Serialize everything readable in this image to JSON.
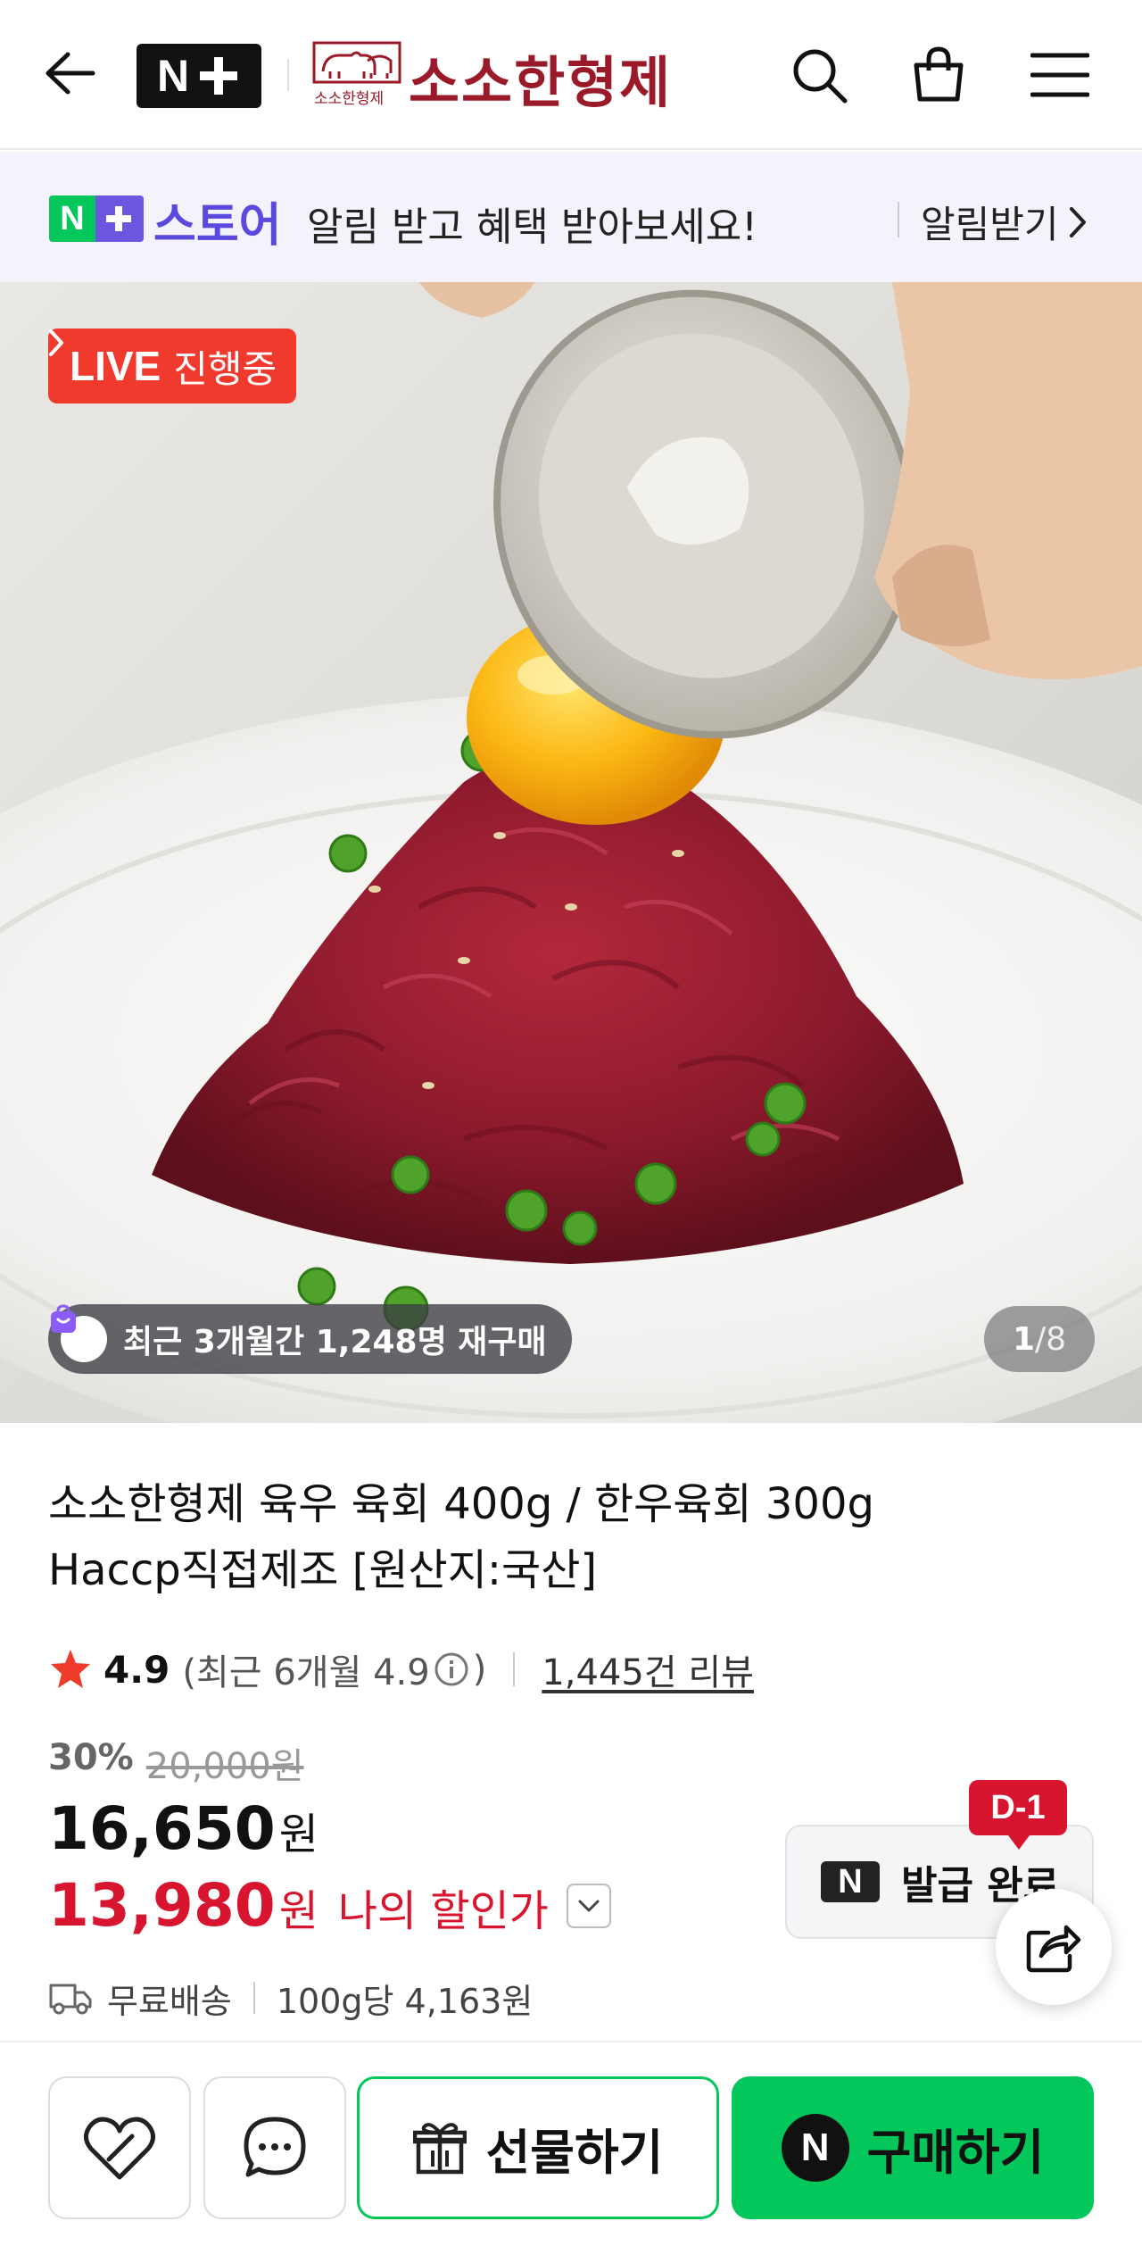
{
  "header": {
    "nplus_label": "N",
    "brand_name": "소소한형제",
    "brand_mark_text": "소소한형제",
    "icons": [
      "back-arrow-icon",
      "search-icon",
      "cart-icon",
      "menu-icon"
    ]
  },
  "notice": {
    "store_label": "스토어",
    "message": "알림 받고 혜택 받아보세요!",
    "cta": "알림받기"
  },
  "hero": {
    "live_label": "LIVE",
    "live_status": "진행중",
    "rebuy_text": "최근 3개월간 1,248명 재구매",
    "counter_current": "1",
    "counter_total": "/8"
  },
  "product": {
    "title_line1": "소소한형제 육우 육회 400g / 한우육회 300g",
    "title_line2": "Haccp직접제조 [원산지:국산]",
    "rating": "4.9",
    "rating_recent_open": "(최근 6개월 4.9",
    "rating_recent_close": ")",
    "review_count": "1,445건 리뷰",
    "discount_rate": "30%",
    "original_price": "20,000원",
    "price": "16,650",
    "price_unit": "원",
    "my_price": "13,980",
    "my_price_unit": "원",
    "my_price_label": "나의 할인가",
    "shipping": "무료배송",
    "unit_price": "100g당 4,163원"
  },
  "coupon": {
    "logo": "N",
    "label": "발급 완료",
    "dday": "D-1"
  },
  "bottom_bar": {
    "gift_label": "선물하기",
    "buy_logo": "N",
    "buy_label": "구매하기"
  },
  "colors": {
    "naver_green": "#03c75a",
    "brand_maroon": "#9b1a2a",
    "sale_red": "#d8152f",
    "live_red": "#f03a2e",
    "store_purple": "#5b48dc"
  }
}
